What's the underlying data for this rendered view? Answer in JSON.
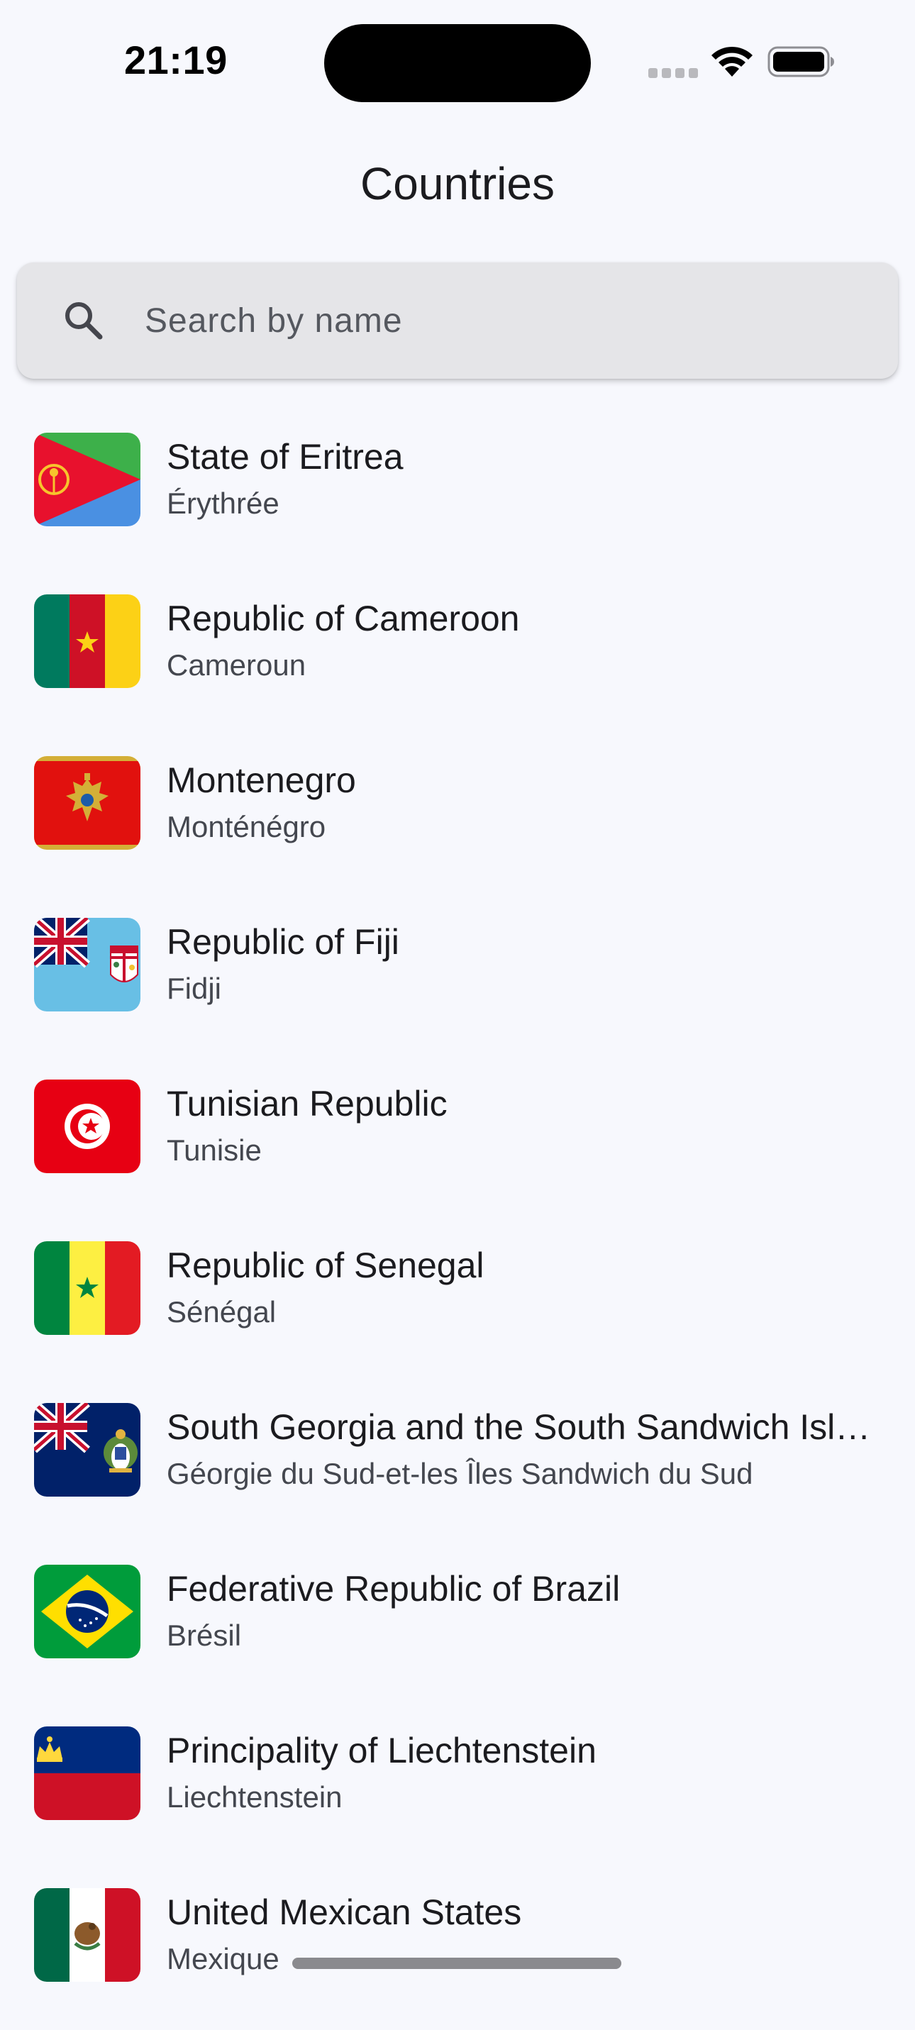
{
  "status_bar": {
    "time": "21:19"
  },
  "app_bar": {
    "title": "Countries"
  },
  "search": {
    "placeholder": "Search by name",
    "value": "",
    "icon": "search-icon"
  },
  "countries": [
    {
      "name": "State of Eritrea",
      "native": "Érythrée",
      "flag": "eritrea-flag"
    },
    {
      "name": "Republic of Cameroon",
      "native": "Cameroun",
      "flag": "cameroon-flag"
    },
    {
      "name": "Montenegro",
      "native": "Monténégro",
      "flag": "montenegro-flag"
    },
    {
      "name": "Republic of Fiji",
      "native": "Fidji",
      "flag": "fiji-flag"
    },
    {
      "name": "Tunisian Republic",
      "native": "Tunisie",
      "flag": "tunisia-flag"
    },
    {
      "name": "Republic of Senegal",
      "native": "Sénégal",
      "flag": "senegal-flag"
    },
    {
      "name": "South Georgia and the South Sandwich Islands",
      "native": "Géorgie du Sud-et-les Îles Sandwich du Sud",
      "flag": "south-georgia-flag"
    },
    {
      "name": "Federative Republic of Brazil",
      "native": "Brésil",
      "flag": "brazil-flag"
    },
    {
      "name": "Principality of Liechtenstein",
      "native": "Liechtenstein",
      "flag": "liechtenstein-flag"
    },
    {
      "name": "United Mexican States",
      "native": "Mexique",
      "flag": "mexico-flag"
    }
  ],
  "colors": {
    "background": "#F7F8FD",
    "search_fill": "#E5E5E8",
    "text_primary": "#1B1B1F",
    "text_secondary": "#44474F"
  }
}
